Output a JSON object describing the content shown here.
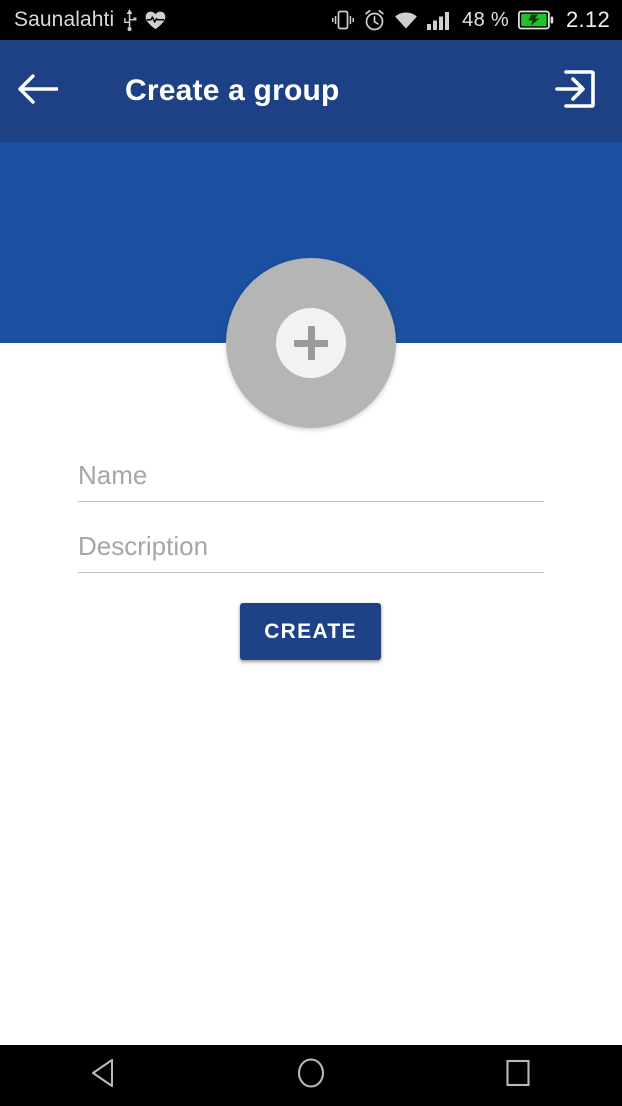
{
  "status_bar": {
    "carrier": "Saunalahti",
    "battery_percent": "48 %",
    "clock": "2.12",
    "icons": {
      "usb": "usb-icon",
      "health": "heart-rate-icon",
      "vibrate": "vibrate-icon",
      "alarm": "alarm-clock-icon",
      "wifi": "wifi-icon",
      "signal": "cellular-signal-icon",
      "battery": "battery-charging-icon"
    },
    "colors": {
      "background": "#000000",
      "text": "#d9d9d9",
      "battery_fill": "#22c32a"
    }
  },
  "app_bar": {
    "title": "Create a group",
    "back_icon": "arrow-back-icon",
    "action_icon": "exit-to-app-icon",
    "color": "#1e4186"
  },
  "banner": {
    "color": "#1b50a0"
  },
  "avatar": {
    "icon": "add-plus-icon",
    "circle_color": "#b5b5b5",
    "inner_color": "#f2f2f2",
    "plus_color": "#9a9a9a"
  },
  "form": {
    "name_field": {
      "value": "",
      "placeholder": "Name"
    },
    "description_field": {
      "value": "",
      "placeholder": "Description"
    },
    "underline_color": "#bdbdbd",
    "placeholder_color": "#a6a6a6"
  },
  "actions": {
    "create_label": "CREATE",
    "create_color": "#1e4187"
  },
  "nav_bar": {
    "back_icon": "nav-back-triangle-icon",
    "home_icon": "nav-home-circle-icon",
    "recents_icon": "nav-recents-square-icon",
    "color": "#000000"
  }
}
